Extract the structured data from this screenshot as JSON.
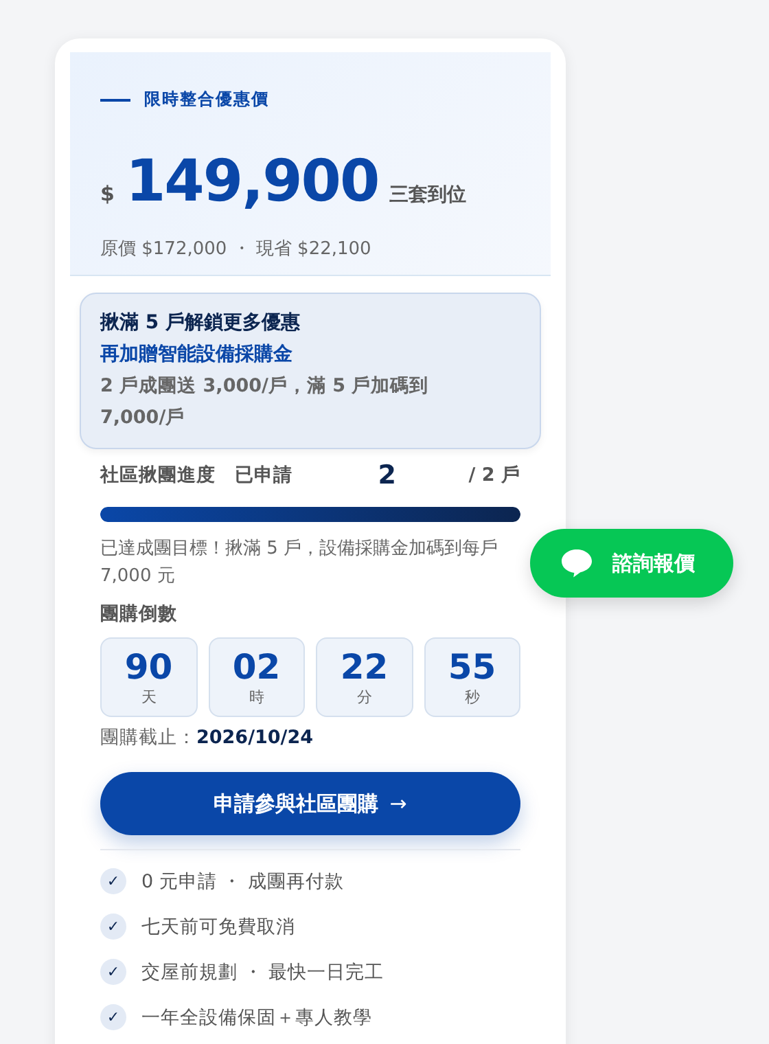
{
  "header": {
    "eyebrow": "限時整合優惠價",
    "currency": "$",
    "price": "149,900",
    "price_note": "三套到位",
    "original": "原價 $172,000 ・ 現省 $22,100"
  },
  "promo": {
    "title": "揪滿 5 戶解鎖更多優惠",
    "subtitle": "再加贈智能設備採購金",
    "detail": "2 戶成團送 3,000/戶，滿 5 戶加碼到 7,000/戶"
  },
  "progress": {
    "label": "社區揪團進度　已申請",
    "count": "2",
    "target": "/ 2 戶",
    "level": 1,
    "note": "已達成團目標！揪滿 5 戶，設備採購金加碼到每戶 7,000 元"
  },
  "countdown": {
    "title": "團購倒數",
    "units": [
      {
        "value": "90",
        "unit": "天"
      },
      {
        "value": "02",
        "unit": "時"
      },
      {
        "value": "22",
        "unit": "分"
      },
      {
        "value": "55",
        "unit": "秒"
      }
    ],
    "deadline_label": "團購截止：",
    "deadline": "2026/10/24"
  },
  "cta": {
    "label": "申請參與社區團購",
    "arrow": "→"
  },
  "benefits": [
    {
      "check": "✓",
      "text": "0 元申請 ・ 成團再付款"
    },
    {
      "check": "✓",
      "text": "七天前可免費取消"
    },
    {
      "check": "✓",
      "text": "交屋前規劃 ・ 最快一日完工"
    },
    {
      "check": "✓",
      "text": "一年全設備保固＋專人教學"
    }
  ],
  "float_button": {
    "label": "諮詢報價"
  }
}
